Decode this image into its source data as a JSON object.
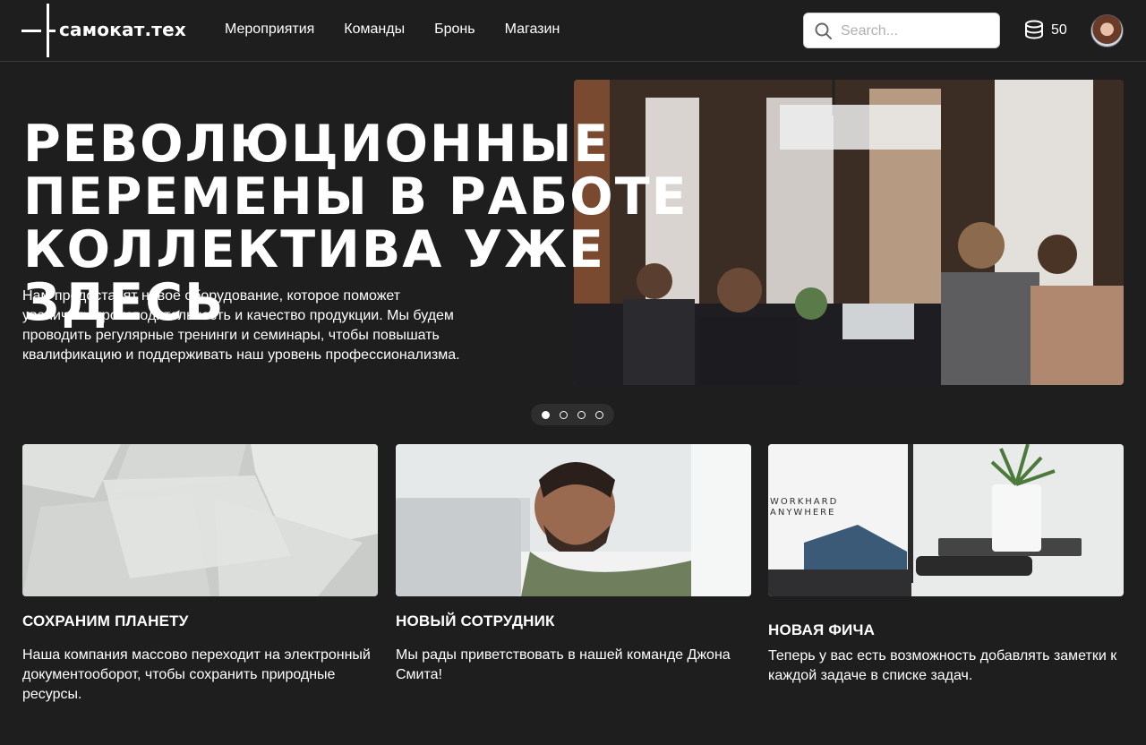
{
  "brand": {
    "name": "самокат.тех"
  },
  "nav": {
    "items": [
      {
        "label": "Мероприятия"
      },
      {
        "label": "Команды"
      },
      {
        "label": "Бронь"
      },
      {
        "label": "Магазин"
      }
    ]
  },
  "search": {
    "placeholder": "Search...",
    "value": ""
  },
  "coins": {
    "value": "50",
    "icon": "coins-stack-icon"
  },
  "user": {
    "avatar": "user-avatar"
  },
  "hero": {
    "title_line1": "Революционные",
    "title_line2": "перемены в работе",
    "title_line3": "коллектива уже здесь",
    "text": "Нам предоставят новое оборудование, которое поможет увеличить производительность и качество продукции. Мы будем проводить регулярные тренинги и семинары, чтобы повышать квалификацию и поддерживать наш уровень профессионализма.",
    "image": "office-team-photo",
    "slides_total": 4,
    "slide_active": 1
  },
  "cards": [
    {
      "title": "Сохраним планету",
      "text": "Наша компания массово переходит на электронный документооборот, чтобы сохранить природные ресурсы.",
      "image": "paper-sheets-photo"
    },
    {
      "title": "Новый сотрудник",
      "text": "Мы рады приветствовать в нашей команде Джона Смита!",
      "image": "new-employee-photo"
    },
    {
      "title": "Новая фича",
      "text": "Теперь у вас есть возможность добавлять заметки к каждой задаче в списке задач.",
      "image": "laptop-desk-photo",
      "image_caption_line1": "WORKHARD",
      "image_caption_line2": "ANYWHERE"
    }
  ]
}
